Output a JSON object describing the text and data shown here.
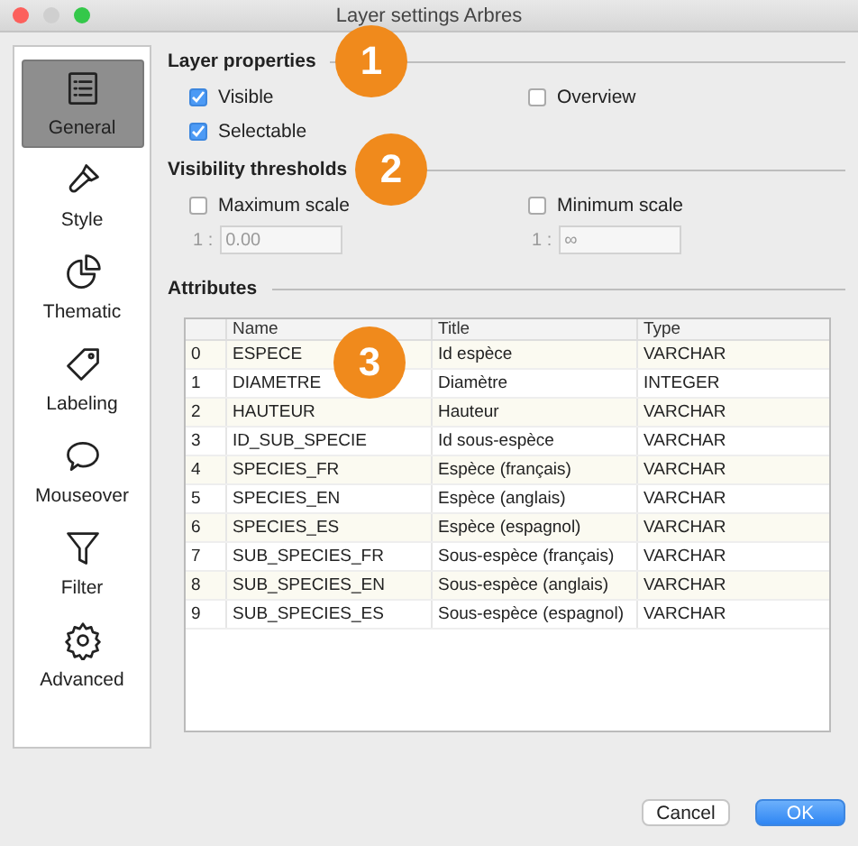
{
  "window": {
    "title": "Layer settings Arbres"
  },
  "sidebar": {
    "items": [
      {
        "label": "General",
        "selected": true
      },
      {
        "label": "Style",
        "selected": false
      },
      {
        "label": "Thematic",
        "selected": false
      },
      {
        "label": "Labeling",
        "selected": false
      },
      {
        "label": "Mouseover",
        "selected": false
      },
      {
        "label": "Filter",
        "selected": false
      },
      {
        "label": "Advanced",
        "selected": false
      }
    ]
  },
  "layer_properties": {
    "title": "Layer properties",
    "callout": "1",
    "options": [
      {
        "label": "Visible",
        "checked": true
      },
      {
        "label": "Overview",
        "checked": false
      },
      {
        "label": "Selectable",
        "checked": true
      }
    ]
  },
  "visibility_thresholds": {
    "title": "Visibility thresholds",
    "callout": "2",
    "scales": [
      {
        "label": "Maximum scale",
        "checked": false,
        "prefix": "1 :",
        "value": "0.00",
        "disabled": true
      },
      {
        "label": "Minimum scale",
        "checked": false,
        "prefix": "1 :",
        "value": "∞",
        "disabled": true
      }
    ]
  },
  "attributes": {
    "title": "Attributes",
    "callout": "3",
    "table": {
      "columns": [
        "Name",
        "Title",
        "Type"
      ],
      "rows": [
        {
          "index": "0",
          "name": "ESPECE",
          "title": "Id espèce",
          "type": "VARCHAR"
        },
        {
          "index": "1",
          "name": "DIAMETRE",
          "title": "Diamètre",
          "type": "INTEGER"
        },
        {
          "index": "2",
          "name": "HAUTEUR",
          "title": "Hauteur",
          "type": "VARCHAR"
        },
        {
          "index": "3",
          "name": "ID_SUB_SPECIE",
          "title": "Id sous-espèce",
          "type": "VARCHAR"
        },
        {
          "index": "4",
          "name": "SPECIES_FR",
          "title": "Espèce (français)",
          "type": "VARCHAR"
        },
        {
          "index": "5",
          "name": "SPECIES_EN",
          "title": "Espèce (anglais)",
          "type": "VARCHAR"
        },
        {
          "index": "6",
          "name": "SPECIES_ES",
          "title": "Espèce (espagnol)",
          "type": "VARCHAR"
        },
        {
          "index": "7",
          "name": "SUB_SPECIES_FR",
          "title": "Sous-espèce (français)",
          "type": "VARCHAR"
        },
        {
          "index": "8",
          "name": "SUB_SPECIES_EN",
          "title": "Sous-espèce (anglais)",
          "type": "VARCHAR"
        },
        {
          "index": "9",
          "name": "SUB_SPECIES_ES",
          "title": "Sous-espèce (espagnol)",
          "type": "VARCHAR"
        }
      ]
    }
  },
  "buttons": [
    {
      "label": "Cancel",
      "kind": "secondary"
    },
    {
      "label": "OK",
      "kind": "primary"
    }
  ]
}
